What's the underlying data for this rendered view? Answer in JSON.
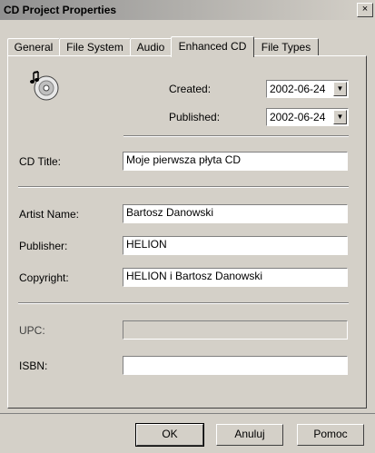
{
  "window": {
    "title": "CD Project Properties",
    "close_glyph": "×"
  },
  "tabs": [
    {
      "label": "General"
    },
    {
      "label": "File System"
    },
    {
      "label": "Audio"
    },
    {
      "label": "Enhanced CD"
    },
    {
      "label": "File Types"
    }
  ],
  "dates": {
    "created_label": "Created:",
    "created_value": "2002-06-24",
    "published_label": "Published:",
    "published_value": "2002-06-24"
  },
  "fields": {
    "cd_title_label": "CD Title:",
    "cd_title_value": "Moje pierwsza płyta CD",
    "artist_label": "Artist Name:",
    "artist_value": "Bartosz Danowski",
    "publisher_label": "Publisher:",
    "publisher_value": "HELION",
    "copyright_label": "Copyright:",
    "copyright_value": "HELION i Bartosz Danowski",
    "upc_label": "UPC:",
    "upc_value": "",
    "isbn_label": "ISBN:",
    "isbn_value": ""
  },
  "buttons": {
    "ok": "OK",
    "cancel": "Anuluj",
    "help": "Pomoc"
  },
  "icons": {
    "cd": "cd-music-icon",
    "dropdown": "dropdown-arrow-icon",
    "close": "close-icon"
  },
  "colors": {
    "window_bg": "#d4d0c8",
    "field_bg": "#ffffff"
  }
}
